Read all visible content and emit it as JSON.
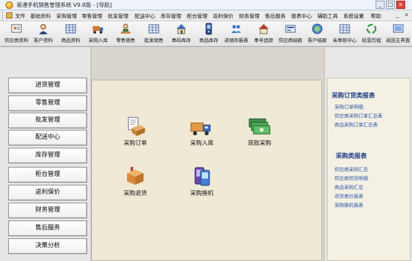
{
  "window": {
    "title": "易通手机销售管理系统 V9.8版 - [导航]",
    "controls": [
      "_",
      "□",
      "×"
    ]
  },
  "menubar": {
    "items": [
      "文件",
      "基础资料",
      "采购管理",
      "零售管理",
      "批发管理",
      "配送中心",
      "库存管理",
      "柜台管理",
      "返利保价",
      "财务管理",
      "售后服务",
      "报表中心",
      "辅助工具",
      "系统设置",
      "帮助"
    ],
    "right_controls": [
      "_",
      "×"
    ]
  },
  "toolbar": {
    "items": [
      {
        "label": "供应商资料",
        "icon": "supplier-card-icon"
      },
      {
        "label": "客户资料",
        "icon": "customer-person-icon"
      },
      {
        "label": "商品资料",
        "icon": "product-grid-icon"
      },
      {
        "label": "采购入库",
        "icon": "truck-icon"
      },
      {
        "label": "零售销售",
        "icon": "clerk-icon"
      },
      {
        "label": "批发销售",
        "icon": "wholesale-grid-icon"
      },
      {
        "label": "串码库存",
        "icon": "house-icon"
      },
      {
        "label": "商品库存",
        "icon": "phone-icon"
      },
      {
        "label": "进销存报表",
        "icon": "people-report-icon"
      },
      {
        "label": "串号追踪",
        "icon": "house-search-icon"
      },
      {
        "label": "供应商结款",
        "icon": "supplier-pay-icon"
      },
      {
        "label": "客户结款",
        "icon": "customer-pay-icon"
      },
      {
        "label": "未审核中心",
        "icon": "audit-grid-icon"
      },
      {
        "label": "经营历程",
        "icon": "recycle-icon"
      },
      {
        "label": "返回主界面",
        "icon": "home-screen-icon"
      }
    ]
  },
  "leftnav": {
    "items": [
      "进货管理",
      "零售管理",
      "批发管理",
      "配送中心",
      "库存管理",
      "柜台管理",
      "返利保价",
      "财务管理",
      "售后服务",
      "决策分析"
    ]
  },
  "center": {
    "functions": [
      {
        "label": "采购订单",
        "icon": "purchase-order-icon"
      },
      {
        "label": "采购入库",
        "icon": "purchase-inbound-icon"
      },
      {
        "label": "现款采购",
        "icon": "cash-purchase-icon"
      },
      {
        "label": "采购退货",
        "icon": "purchase-return-icon"
      },
      {
        "label": "采购换机",
        "icon": "purchase-exchange-icon"
      }
    ]
  },
  "rightpanel": {
    "sections": [
      {
        "title": "采购订货类报表",
        "links": [
          "采购订单明细",
          "供应商采购订单汇总表",
          "商品采购订单汇总表"
        ]
      },
      {
        "title": "采购类报表",
        "links": [
          "供应商采购汇总",
          "供应商供货明细",
          "商品采购汇总",
          "进货差价报表",
          "采购换机报表"
        ]
      }
    ]
  },
  "colors": {
    "heading": "#1e3f8a",
    "link": "#2a54a8",
    "content_bg": "#efe9d6"
  }
}
